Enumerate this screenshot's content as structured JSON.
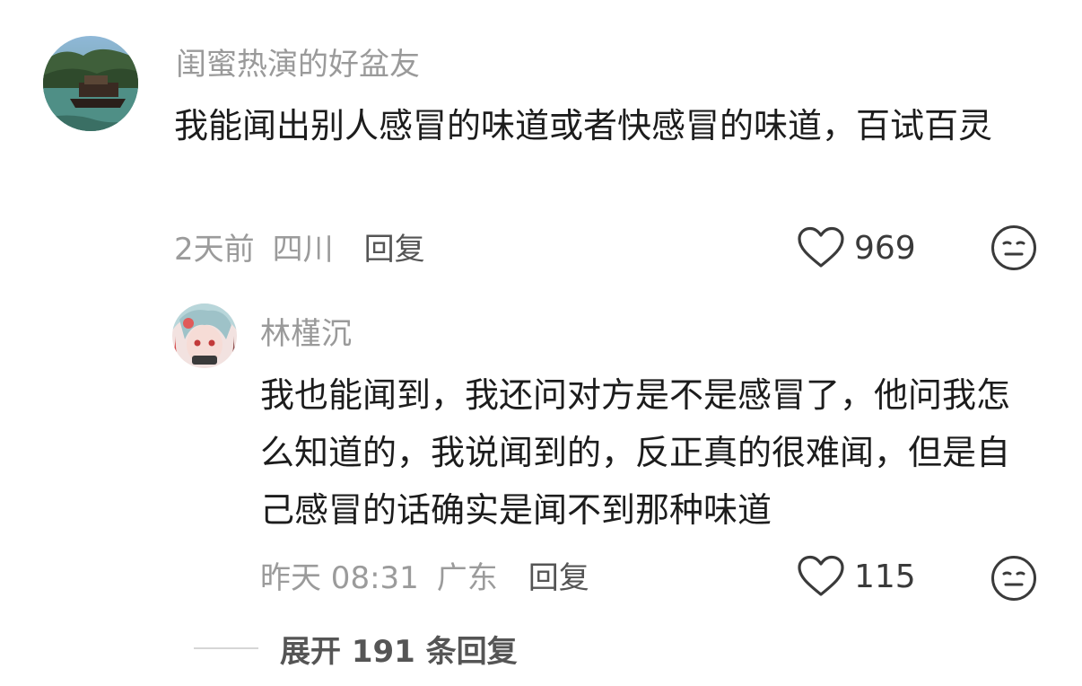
{
  "comment": {
    "username": "闺蜜热演的好盆友",
    "text": "我能闻出别人感冒的味道或者快感冒的味道，百试百灵",
    "time": "2天前",
    "location": "四川",
    "reply_label": "回复",
    "likes": "969",
    "avatar_icon": "landscape-boat-avatar"
  },
  "reply": {
    "username": "林槿沉",
    "text": "我也能闻到，我还问对方是不是感冒了，他问我怎么知道的，我说闻到的，反正真的很难闻，但是自己感冒的话确实是闻不到那种味道",
    "time": "昨天 08:31",
    "location": "广东",
    "reply_label": "回复",
    "likes": "115",
    "avatar_icon": "anime-character-avatar"
  },
  "expand": {
    "label": "展开 191 条回复"
  },
  "icons": {
    "like": "heart-outline-icon",
    "emoji": "smile-face-icon"
  },
  "colors": {
    "text": "#1c1c1c",
    "meta": "#9b9b9b",
    "reply_action": "#555555"
  }
}
